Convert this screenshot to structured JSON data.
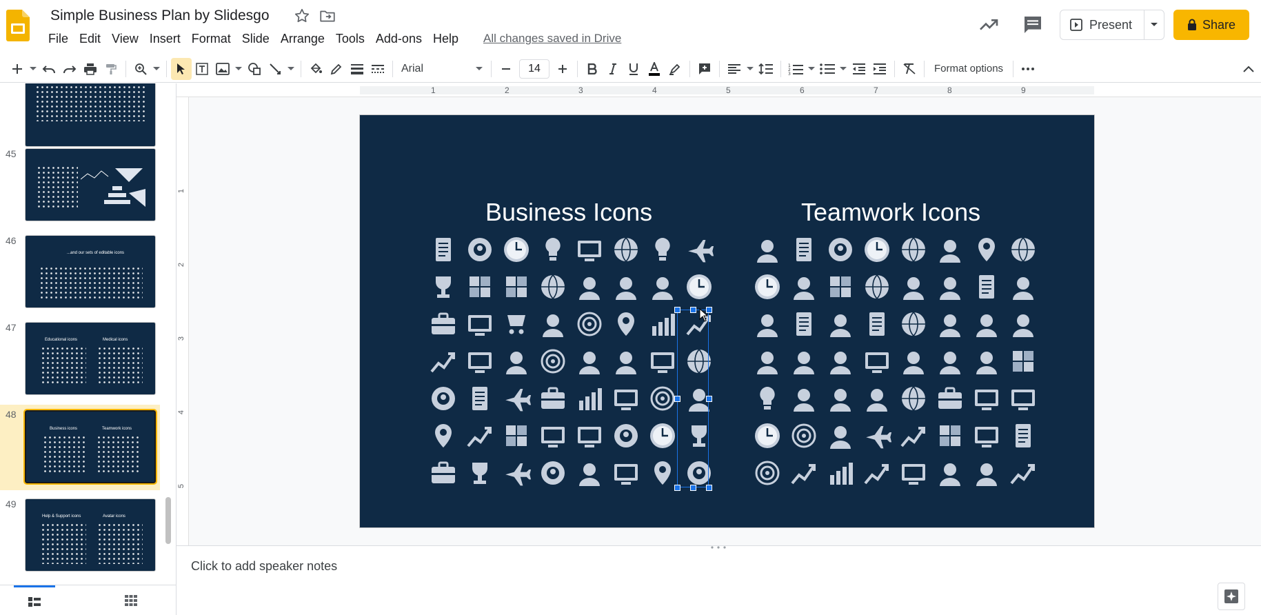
{
  "app": {
    "title": "Simple Business Plan by Slidesgo",
    "saved_status": "All changes saved in Drive"
  },
  "menu": [
    "File",
    "Edit",
    "View",
    "Insert",
    "Format",
    "Slide",
    "Arrange",
    "Tools",
    "Add-ons",
    "Help"
  ],
  "header": {
    "present_label": "Present",
    "share_label": "Share"
  },
  "toolbar": {
    "font": "Arial",
    "font_size": "14",
    "format_options": "Format options"
  },
  "ruler": {
    "h_ticks": [
      "1",
      "2",
      "3",
      "4",
      "5",
      "6",
      "7",
      "8",
      "9"
    ],
    "v_ticks": [
      "1",
      "2",
      "3",
      "4",
      "5"
    ]
  },
  "filmstrip": {
    "slides": [
      {
        "number": "",
        "titles": []
      },
      {
        "number": "45",
        "titles": []
      },
      {
        "number": "46",
        "titles": [
          "...and our sets of editable icons"
        ]
      },
      {
        "number": "47",
        "titles": [
          "Educational icons",
          "Medical icons"
        ]
      },
      {
        "number": "48",
        "titles": [
          "Business icons",
          "Teamwork icons"
        ]
      },
      {
        "number": "49",
        "titles": [
          "Help & Support icons",
          "Avatar icons"
        ]
      }
    ],
    "selected": "48"
  },
  "slide": {
    "heading_left": "Business Icons",
    "heading_right": "Teamwork Icons",
    "icon_color": "#c7d0dd",
    "background": "#0f2a45"
  },
  "notes": {
    "placeholder": "Click to add speaker notes"
  },
  "colors": {
    "accent": "#f8b600",
    "selection": "#1a73e8"
  }
}
